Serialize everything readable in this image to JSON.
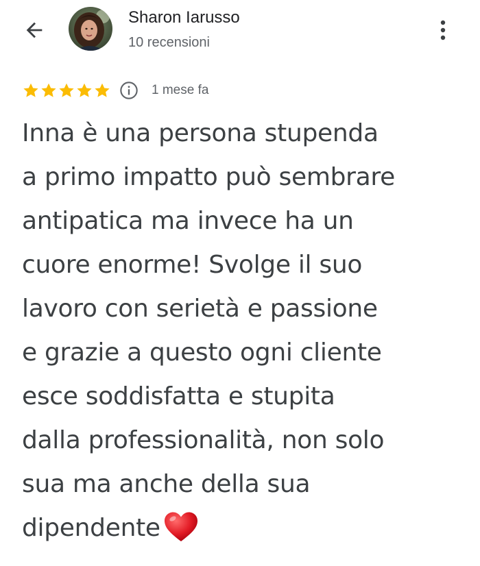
{
  "header": {
    "back_icon": "arrow-back-icon",
    "reviewer_name": "Sharon Iarusso",
    "review_count": "10 recensioni",
    "more_icon": "more-vert-icon"
  },
  "review": {
    "rating": 5,
    "rating_max": 5,
    "star_color": "#fbbc04",
    "info_icon": "info-icon",
    "date": "1 mese fa",
    "text_lines": [
      "Inna è una persona stupenda",
      "a primo impatto può sembrare",
      "antipatica ma invece ha un",
      "cuore enorme! Svolge il suo",
      "lavoro con serietà e passione",
      "e grazie a questo ogni cliente",
      "esce soddisfatta e stupita",
      "dalla professionalità, non solo",
      "sua ma anche della sua",
      "dipendente"
    ],
    "emoji": "heart-icon"
  }
}
